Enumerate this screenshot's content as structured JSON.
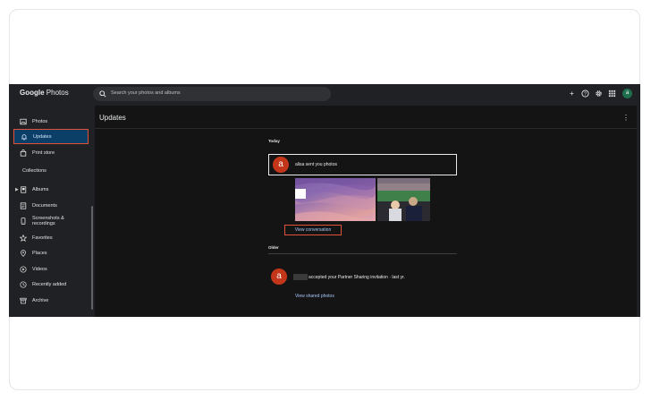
{
  "app": {
    "brand_bold": "Google",
    "brand_rest": " Photos"
  },
  "search": {
    "placeholder": "Search your photos and albums"
  },
  "header": {
    "avatar_letter": "a"
  },
  "sidebar": {
    "items": [
      {
        "label": "Photos",
        "icon": "photo-icon"
      },
      {
        "label": "Updates",
        "icon": "bell-icon",
        "active": true
      },
      {
        "label": "Print store",
        "icon": "bag-icon"
      }
    ],
    "collections_title": "Collections",
    "collections": [
      {
        "label": "Albums",
        "icon": "album-icon"
      },
      {
        "label": "Documents",
        "icon": "document-icon"
      },
      {
        "label": "Screenshots &",
        "label2": "recordings",
        "icon": "screenshot-icon"
      },
      {
        "label": "Favorites",
        "icon": "star-icon"
      },
      {
        "label": "Places",
        "icon": "place-icon"
      },
      {
        "label": "Videos",
        "icon": "video-icon"
      },
      {
        "label": "Recently added",
        "icon": "clock-icon"
      },
      {
        "label": "Archive",
        "icon": "archive-icon"
      }
    ]
  },
  "main": {
    "title": "Updates",
    "today_label": "Today",
    "today_update": {
      "avatar_letter": "a",
      "text": "alisa sent you photos"
    },
    "view_conversation": "View conversation",
    "older_label": "Older",
    "older_update": {
      "avatar_letter": "a",
      "text": "accepted your Partner Sharing invitation · last yr."
    },
    "view_shared": "View shared photos"
  },
  "colors": {
    "accent_link": "#a8c7fa",
    "badge": "#c4361a",
    "active_nav_bg": "#0b3f67",
    "highlight_border": "#e0523a"
  }
}
